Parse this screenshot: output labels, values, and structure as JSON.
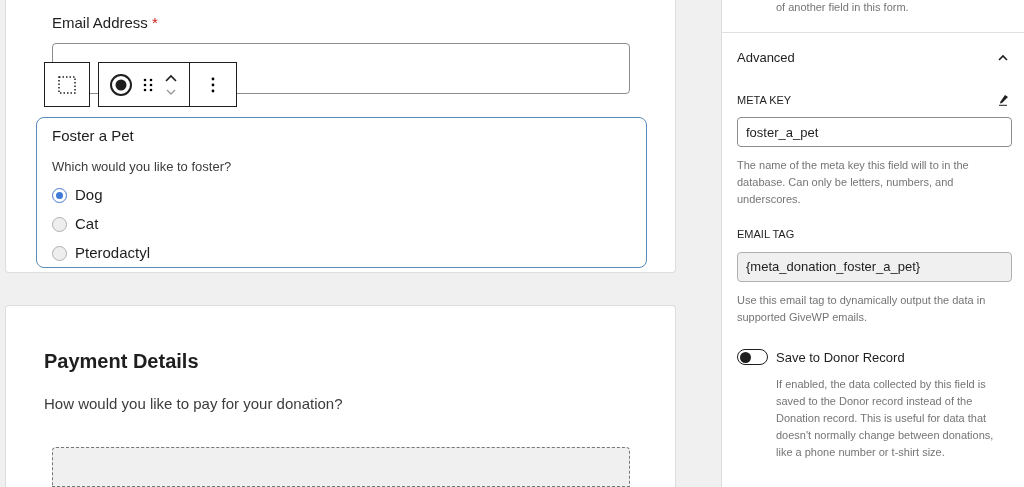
{
  "form": {
    "email_field": {
      "label": "Email Address",
      "required_mark": "*"
    },
    "foster_block": {
      "title": "Foster a Pet",
      "question": "Which would you like to foster?",
      "options": [
        {
          "label": "Dog",
          "selected": true
        },
        {
          "label": "Cat",
          "selected": false
        },
        {
          "label": "Pterodactyl",
          "selected": false
        }
      ]
    },
    "payment_section": {
      "title": "Payment Details",
      "question": "How would you like to pay for your donation?"
    }
  },
  "sidebar": {
    "top_note": "of another field in this form.",
    "section_title": "Advanced",
    "expanded": true,
    "meta_key": {
      "label": "META KEY",
      "value": "foster_a_pet",
      "help": "The name of the meta key this field will to in the database. Can only be letters, numbers, and underscores."
    },
    "email_tag": {
      "label": "EMAIL TAG",
      "value": "{meta_donation_foster_a_pet}",
      "help": "Use this email tag to dynamically output the data in supported GiveWP emails."
    },
    "save_to_donor": {
      "label": "Save to Donor Record",
      "on": false,
      "help": "If enabled, the data collected by this field is saved to the Donor record instead of the Donation record. This is useful for data that doesn't normally change between donations, like a phone number or t-shirt size."
    }
  }
}
